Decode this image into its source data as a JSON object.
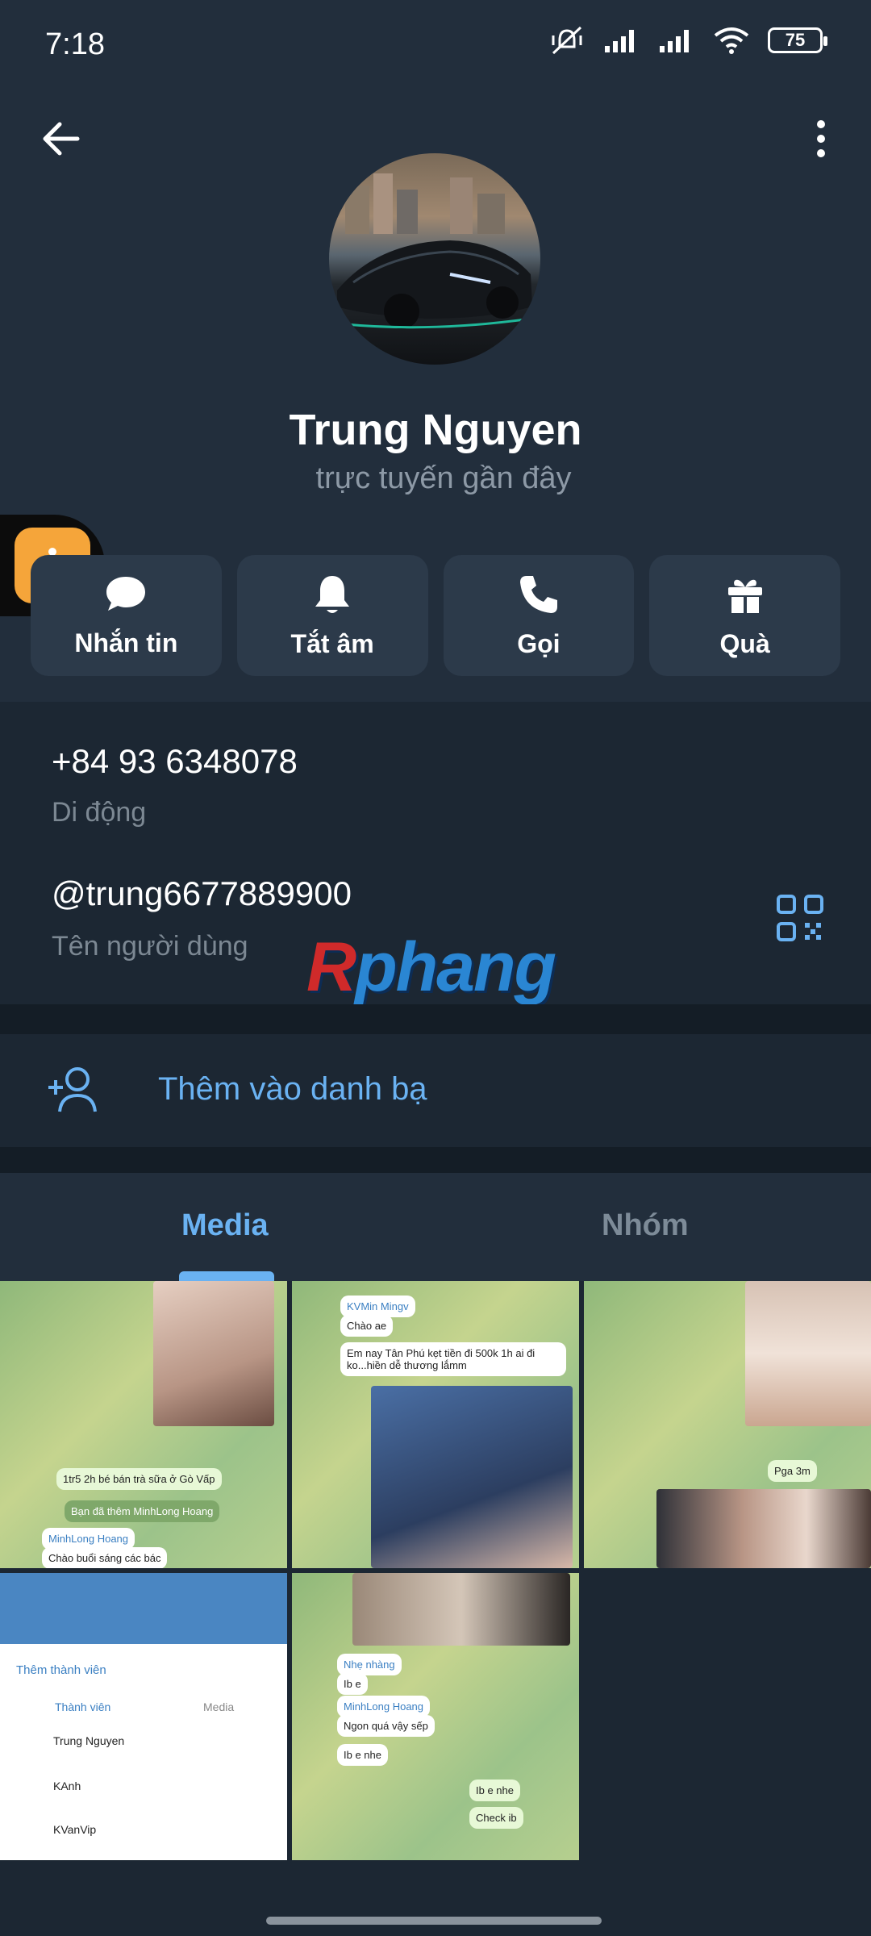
{
  "status_bar": {
    "time": "7:18",
    "battery": "75"
  },
  "profile": {
    "name": "Trung Nguyen",
    "status": "trực tuyến gần đây"
  },
  "actions": [
    {
      "label": "Nhắn tin",
      "icon": "chat-bubble-icon"
    },
    {
      "label": "Tắt âm",
      "icon": "bell-icon"
    },
    {
      "label": "Gọi",
      "icon": "phone-icon"
    },
    {
      "label": "Quà",
      "icon": "gift-icon"
    }
  ],
  "info": {
    "phone": "+84 93 6348078",
    "phone_label": "Di động",
    "username": "@trung6677889900",
    "username_label": "Tên người dùng"
  },
  "watermark": {
    "part1": "R",
    "part2": "phang"
  },
  "add_contact": {
    "label": "Thêm vào danh bạ"
  },
  "tabs": [
    {
      "label": "Media",
      "active": true
    },
    {
      "label": "Nhóm",
      "active": false
    }
  ],
  "media_thumbs": [
    {
      "texts": [
        "1tr5 2h bé bán trà sữa ở Gò Vấp",
        "Bạn đã thêm MinhLong Hoang",
        "MinhLong Hoang",
        "Chào buổi sáng các bác"
      ]
    },
    {
      "texts": [
        "KVMin Mingv",
        "Chào ae",
        "Em nay Tân Phú kẹt tiền đi 500k 1h ai đi ko...hiền dễ thương lắmm"
      ]
    },
    {
      "texts": [
        "Pga 3m"
      ]
    },
    {
      "texts": [
        "Thêm thành viên",
        "Thành viên",
        "Media",
        "Trung Nguyen",
        "KAnh",
        "KVanVip"
      ]
    },
    {
      "texts": [
        "Nhẹ nhàng",
        "Ib e",
        "MinhLong Hoang",
        "Ngon quá vậy sếp",
        "Ib e nhe",
        "Ib e nhe",
        "Check ib"
      ]
    }
  ],
  "colors": {
    "accent": "#6ab2f2",
    "background": "#1c2733",
    "header": "#222e3c",
    "button": "#2c3a4a"
  }
}
